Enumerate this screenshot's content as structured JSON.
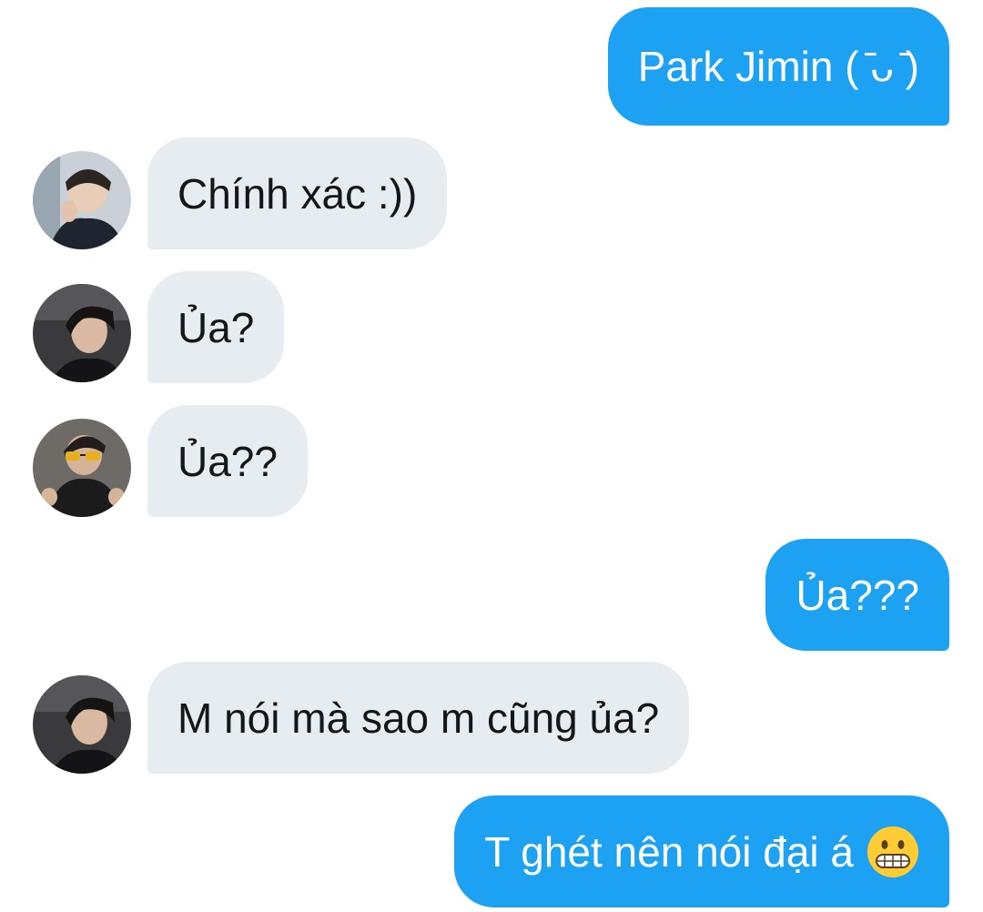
{
  "conversation": {
    "messages": [
      {
        "sender": "me",
        "text": "Park Jimin ( ̄ᴗ ̄)"
      },
      {
        "sender": "other",
        "avatar": "avatar-light-outfit",
        "text": "Chính xác :))"
      },
      {
        "sender": "other",
        "avatar": "avatar-dark-hair",
        "text": "Ủa?"
      },
      {
        "sender": "other",
        "avatar": "avatar-glasses",
        "text": "Ủa??"
      },
      {
        "sender": "me",
        "text": "Ủa???"
      },
      {
        "sender": "other",
        "avatar": "avatar-dark-hair",
        "text": "M nói mà sao m cũng ủa?"
      },
      {
        "sender": "me",
        "text": "T ghét nên nói đại á",
        "emoji": "grimacing-face-icon"
      }
    ]
  },
  "colors": {
    "outgoing_bubble": "#1da1f2",
    "incoming_bubble": "#e6ecf0",
    "incoming_text": "#14171a",
    "outgoing_text": "#ffffff"
  }
}
